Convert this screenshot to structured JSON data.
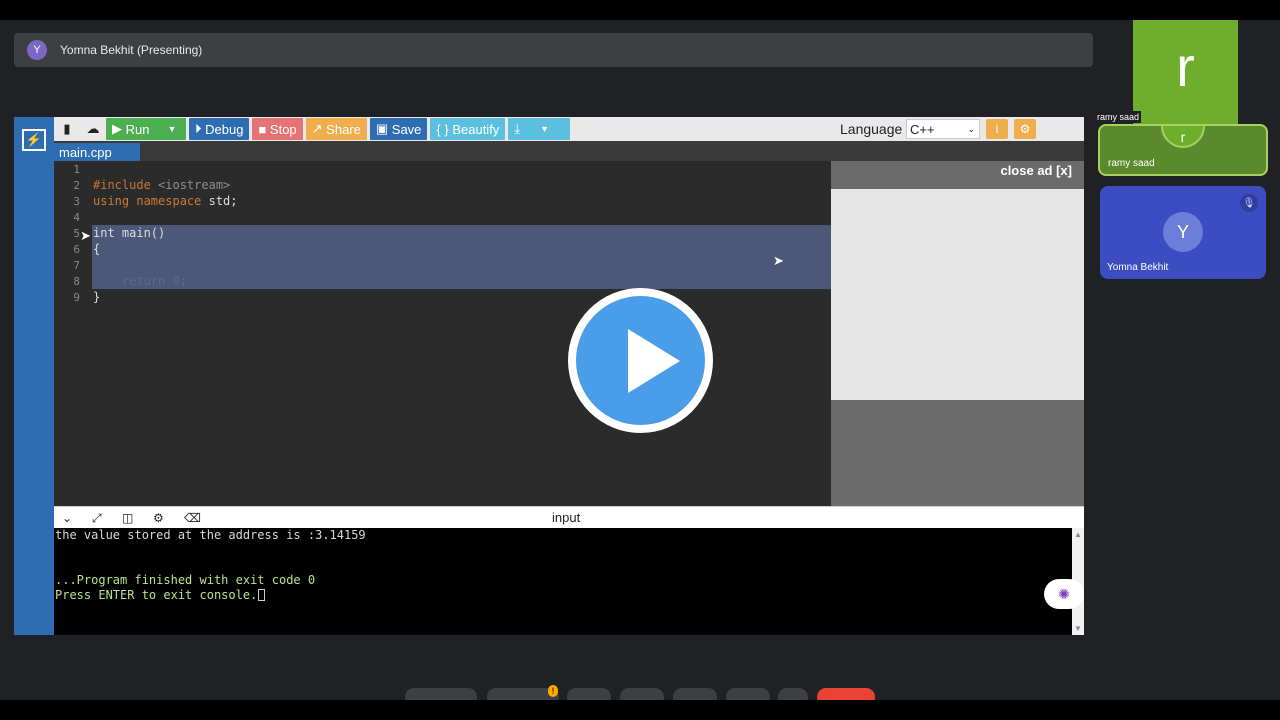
{
  "meeting": {
    "presenter_avatar": "Y",
    "presenter_label": "Yomna Bekhit (Presenting)"
  },
  "toolbar": {
    "run_label": "Run",
    "debug_label": "Debug",
    "stop_label": "Stop",
    "share_label": "Share",
    "save_label": "Save",
    "beautify_label": "{ } Beautify",
    "language_label": "Language",
    "language_value": "C++",
    "icons": [
      "new-file-icon",
      "upload-icon",
      "play-icon",
      "chevron-down-icon",
      "debug-icon",
      "stop-icon",
      "share-icon",
      "save-icon",
      "download-icon",
      "info-icon",
      "gear-icon"
    ]
  },
  "editor": {
    "tab_name": "main.cpp",
    "line_numbers": [
      "1",
      "2",
      "3",
      "4",
      "5",
      "6",
      "7",
      "8",
      "9"
    ],
    "code": {
      "l2_a": "#include",
      "l2_b": " <iostream>",
      "l3_a": "using",
      "l3_b": " namespace",
      "l3_c": " std;",
      "l5": "int main()",
      "l6": "{",
      "l8_a": "    return",
      "l8_b": " 0;",
      "l9": "}"
    }
  },
  "ad": {
    "close_label": "close ad [x]"
  },
  "console": {
    "header_label": "input",
    "line1": "the value stored at the address is :3.14159",
    "line2": "...Program finished with exit code 0",
    "line3": "Press ENTER to exit console."
  },
  "participants": {
    "main_tile_letter": "r",
    "main_tile_name": "ramy saad",
    "tile1_letter": "r",
    "tile1_name": "ramy saad",
    "tile2_letter": "Y",
    "tile2_name": "Yomna Bekhit"
  },
  "colors": {
    "ide_blue": "#2f6db3",
    "run_green": "#4caf50",
    "play_blue": "#4a9de8",
    "participant_green": "#6fae2c",
    "participant_blue": "#3b4dc1"
  }
}
